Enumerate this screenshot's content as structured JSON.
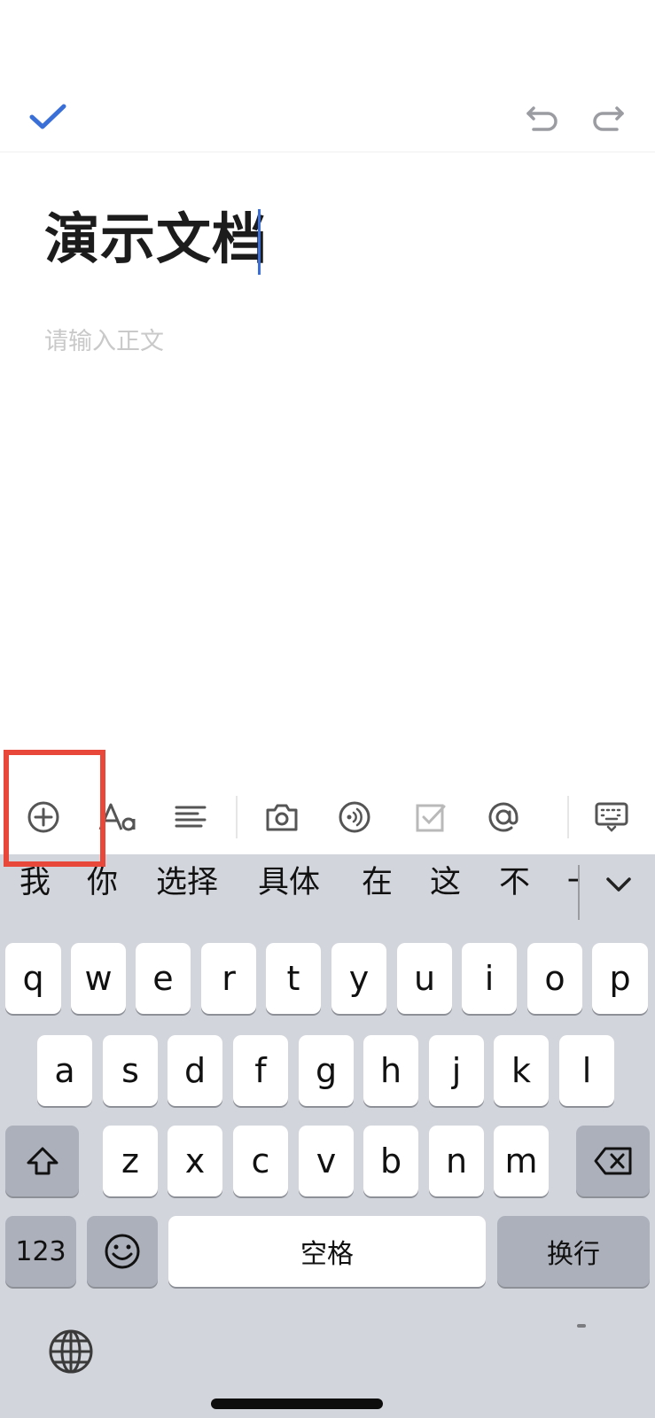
{
  "toolbar_top": {
    "confirm_icon": "check-icon",
    "undo_icon": "undo-icon",
    "redo_icon": "redo-icon",
    "accent_color": "#3a6fd8"
  },
  "document": {
    "title": "演示文档",
    "body_placeholder": "请输入正文"
  },
  "format_toolbar": {
    "items": [
      "add-icon",
      "text-style-icon",
      "align-icon",
      "camera-icon",
      "audio-icon",
      "checkbox-icon",
      "mention-icon",
      "keyboard-hide-icon"
    ]
  },
  "highlight_color": "#e8483a",
  "keyboard": {
    "candidates": [
      "我",
      "你",
      "选择",
      "具体",
      "在",
      "这",
      "不",
      "一"
    ],
    "rows": [
      [
        "q",
        "w",
        "e",
        "r",
        "t",
        "y",
        "u",
        "i",
        "o",
        "p"
      ],
      [
        "a",
        "s",
        "d",
        "f",
        "g",
        "h",
        "j",
        "k",
        "l"
      ],
      [
        "z",
        "x",
        "c",
        "v",
        "b",
        "n",
        "m"
      ]
    ],
    "numbers_key": "123",
    "space_key": "空格",
    "return_key": "换行"
  }
}
